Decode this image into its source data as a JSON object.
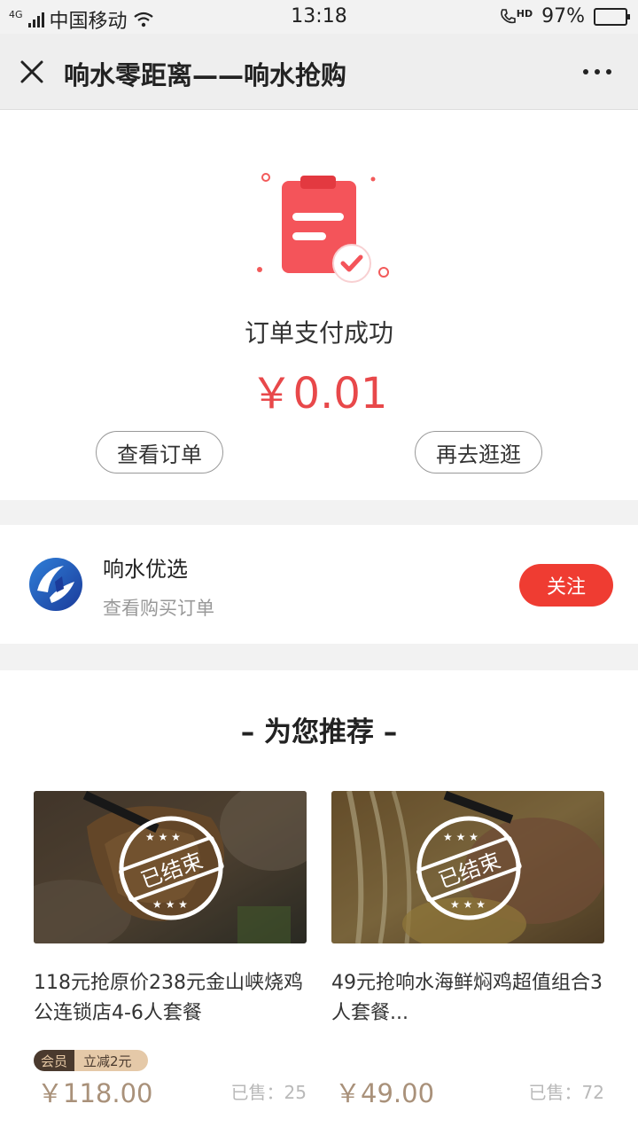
{
  "status_bar": {
    "network": "4G",
    "carrier": "中国移动",
    "time": "13:18",
    "hd_label": "HD",
    "battery": "97%",
    "battery_level": 0.97
  },
  "nav": {
    "title": "响水零距离——响水抢购",
    "close_icon": "close-icon",
    "more_icon": "more-icon"
  },
  "order": {
    "status": "订单支付成功",
    "amount": "￥0.01",
    "view_order": "查看订单",
    "shop_again": "再去逛逛"
  },
  "shop": {
    "name": "响水优选",
    "subtitle": "查看购买订单",
    "follow": "关注"
  },
  "recommend": {
    "heading": "– 为您推荐 –",
    "items": [
      {
        "title": "118元抢原价238元金山峡烧鸡公连锁店4-6人套餐",
        "ended": "已结束",
        "badge_member": "会员",
        "badge_discount": "立减2元",
        "price": "￥118.00",
        "sold": "已售：25"
      },
      {
        "title": "49元抢响水海鲜焖鸡超值组合3人套餐...",
        "ended": "已结束",
        "price": "￥49.00",
        "sold": "已售：72"
      }
    ]
  },
  "colors": {
    "accent": "#e8484a",
    "follow_button": "#ef3c32",
    "price": "#a9917a"
  }
}
